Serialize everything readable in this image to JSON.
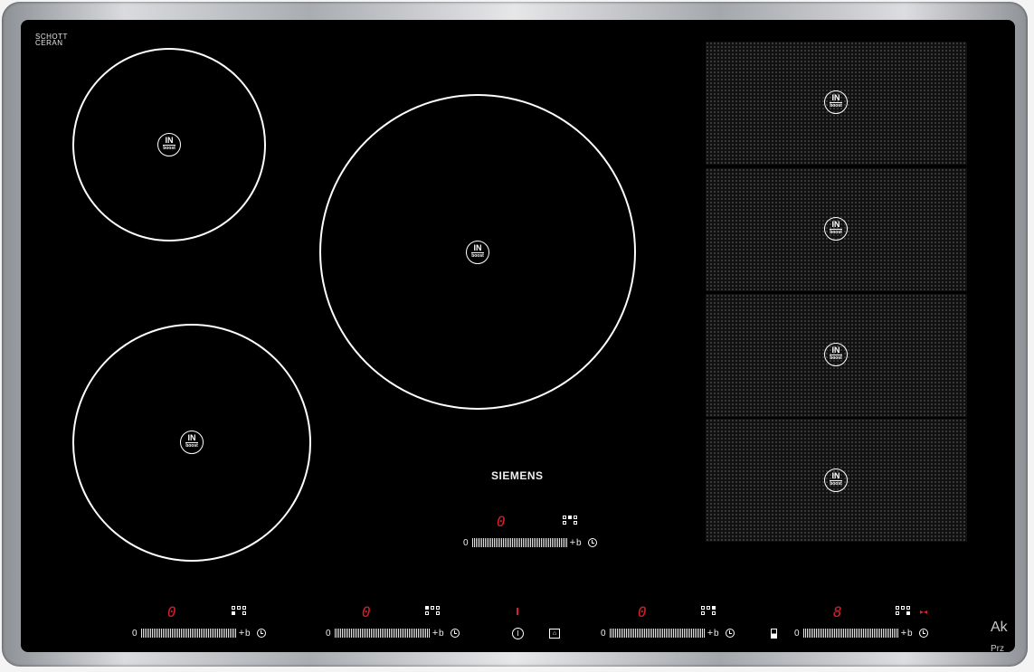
{
  "cooktop": {
    "glass_label_line1": "SCHOTT",
    "glass_label_line2": "CERAN",
    "brand": "SIEMENS",
    "boost_in": "IN",
    "boost_text": "boost",
    "main_display": "0",
    "zone_displays": [
      "0",
      "0",
      "0",
      "8"
    ],
    "slider_zero": "0",
    "slider_plus": "+",
    "slider_b": "b"
  },
  "watermark": {
    "line1": "Ak",
    "line2": "Prz"
  },
  "colors": {
    "glass": "#000000",
    "ring": "#ffffff",
    "display_red": "#d8202a",
    "frame": "#b8bbbf"
  }
}
